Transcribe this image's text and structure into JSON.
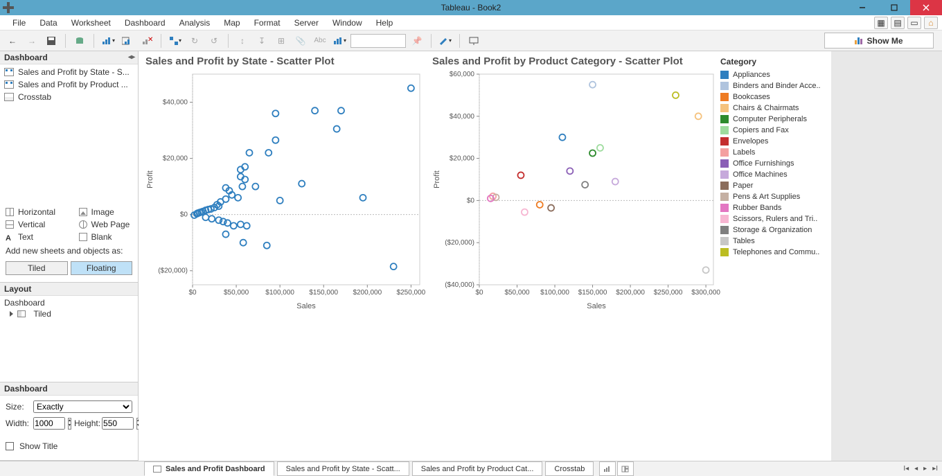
{
  "window": {
    "title": "Tableau - Book2"
  },
  "menu": [
    "File",
    "Data",
    "Worksheet",
    "Dashboard",
    "Analysis",
    "Map",
    "Format",
    "Server",
    "Window",
    "Help"
  ],
  "showme_label": "Show Me",
  "sidebar": {
    "dashboard_title": "Dashboard",
    "sheets": [
      {
        "label": "Sales and Profit by State - S...",
        "type": "db"
      },
      {
        "label": "Sales and Profit by Product ...",
        "type": "db"
      },
      {
        "label": "Crosstab",
        "type": "ct"
      }
    ],
    "objects": {
      "horizontal": "Horizontal",
      "vertical": "Vertical",
      "text": "Text",
      "image": "Image",
      "webpage": "Web Page",
      "blank": "Blank"
    },
    "add_instr": "Add new sheets and objects as:",
    "tiled": "Tiled",
    "floating": "Floating",
    "layout_title": "Layout",
    "layout_root": "Dashboard",
    "layout_child": "Tiled",
    "settings_title": "Dashboard",
    "size_label": "Size:",
    "size_value": "Exactly",
    "width_label": "Width:",
    "width_value": "1000",
    "height_label": "Height:",
    "height_value": "550",
    "show_title": "Show Title"
  },
  "chart1_title": "Sales and Profit by State - Scatter Plot",
  "chart2_title": "Sales and Profit by Product Category - Scatter Plot",
  "axis_x": "Sales",
  "axis_y": "Profit",
  "legend_title": "Category",
  "legend_items": [
    {
      "label": "Appliances",
      "color": "#2f7fbf"
    },
    {
      "label": "Binders and Binder Acce..",
      "color": "#b0c4de"
    },
    {
      "label": "Bookcases",
      "color": "#ee7b22"
    },
    {
      "label": "Chairs & Chairmats",
      "color": "#f5c27d"
    },
    {
      "label": "Computer Peripherals",
      "color": "#2e8b2e"
    },
    {
      "label": "Copiers and Fax",
      "color": "#9edc9e"
    },
    {
      "label": "Envelopes",
      "color": "#c42e2e"
    },
    {
      "label": "Labels",
      "color": "#f4a0a0"
    },
    {
      "label": "Office Furnishings",
      "color": "#8b5fb6"
    },
    {
      "label": "Office Machines",
      "color": "#c6a9db"
    },
    {
      "label": "Paper",
      "color": "#8b6d5c"
    },
    {
      "label": "Pens & Art Supplies",
      "color": "#c5b0a3"
    },
    {
      "label": "Rubber Bands",
      "color": "#e377c2"
    },
    {
      "label": "Scissors, Rulers and Tri..",
      "color": "#f7b6d2"
    },
    {
      "label": "Storage & Organization",
      "color": "#7f7f7f"
    },
    {
      "label": "Tables",
      "color": "#c7c7c7"
    },
    {
      "label": "Telephones and Commu..",
      "color": "#bcbd22"
    }
  ],
  "tabs": [
    {
      "label": "Sales and Profit Dashboard",
      "type": "db",
      "active": true
    },
    {
      "label": "Sales and Profit by State - Scatt...",
      "type": "ws"
    },
    {
      "label": "Sales and Profit by Product Cat...",
      "type": "ws"
    },
    {
      "label": "Crosstab",
      "type": "ws"
    }
  ],
  "chart_data": [
    {
      "type": "scatter",
      "title": "Sales and Profit by State - Scatter Plot",
      "xlabel": "Sales",
      "ylabel": "Profit",
      "xlim": [
        0,
        260000
      ],
      "ylim": [
        -25000,
        50000
      ],
      "xticks": [
        0,
        50000,
        100000,
        150000,
        200000,
        250000
      ],
      "xtick_labels": [
        "$0",
        "$50,000",
        "$100,000",
        "$150,000",
        "$200,000",
        "$250,000"
      ],
      "yticks": [
        -20000,
        0,
        20000,
        40000
      ],
      "ytick_labels": [
        "($20,000)",
        "$0",
        "$20,000",
        "$40,000"
      ],
      "color": "#2f7fbf",
      "points": [
        [
          250000,
          45000
        ],
        [
          170000,
          37000
        ],
        [
          140000,
          37000
        ],
        [
          95000,
          36000
        ],
        [
          165000,
          30500
        ],
        [
          95000,
          26500
        ],
        [
          87000,
          22000
        ],
        [
          65000,
          22000
        ],
        [
          60000,
          17000
        ],
        [
          55000,
          16000
        ],
        [
          55000,
          13500
        ],
        [
          60000,
          12500
        ],
        [
          125000,
          11000
        ],
        [
          72000,
          10000
        ],
        [
          57000,
          10000
        ],
        [
          38000,
          9500
        ],
        [
          42000,
          8500
        ],
        [
          45000,
          7000
        ],
        [
          52000,
          6000
        ],
        [
          38000,
          5500
        ],
        [
          195000,
          6000
        ],
        [
          100000,
          5000
        ],
        [
          32000,
          4500
        ],
        [
          28000,
          3500
        ],
        [
          30000,
          3000
        ],
        [
          25000,
          2500
        ],
        [
          21000,
          2000
        ],
        [
          18000,
          1800
        ],
        [
          15000,
          1500
        ],
        [
          12000,
          1100
        ],
        [
          10000,
          900
        ],
        [
          8000,
          700
        ],
        [
          6000,
          500
        ],
        [
          5000,
          300
        ],
        [
          2000,
          -200
        ],
        [
          15000,
          -1000
        ],
        [
          22000,
          -1500
        ],
        [
          30000,
          -2000
        ],
        [
          35000,
          -2500
        ],
        [
          40000,
          -3000
        ],
        [
          47000,
          -4000
        ],
        [
          55000,
          -3500
        ],
        [
          62000,
          -4000
        ],
        [
          38000,
          -7000
        ],
        [
          58000,
          -10000
        ],
        [
          85000,
          -11000
        ],
        [
          230000,
          -18500
        ]
      ]
    },
    {
      "type": "scatter",
      "title": "Sales and Profit by Product Category - Scatter Plot",
      "xlabel": "Sales",
      "ylabel": "Profit",
      "xlim": [
        0,
        310000
      ],
      "ylim": [
        -40000,
        60000
      ],
      "xticks": [
        0,
        50000,
        100000,
        150000,
        200000,
        250000,
        300000
      ],
      "xtick_labels": [
        "$0",
        "$50,000",
        "$100,000",
        "$150,000",
        "$200,000",
        "$250,000",
        "$300,000"
      ],
      "yticks": [
        -40000,
        -20000,
        0,
        20000,
        40000,
        60000
      ],
      "ytick_labels": [
        "($40,000)",
        "($20,000)",
        "$0",
        "$20,000",
        "$40,000",
        "$60,000"
      ],
      "points": [
        {
          "x": 150000,
          "y": 55000,
          "color": "#b0c4de"
        },
        {
          "x": 260000,
          "y": 50000,
          "color": "#bcbd22"
        },
        {
          "x": 290000,
          "y": 40000,
          "color": "#f5c27d"
        },
        {
          "x": 110000,
          "y": 30000,
          "color": "#2f7fbf"
        },
        {
          "x": 160000,
          "y": 25000,
          "color": "#9edc9e"
        },
        {
          "x": 150000,
          "y": 22500,
          "color": "#2e8b2e"
        },
        {
          "x": 120000,
          "y": 14000,
          "color": "#8b5fb6"
        },
        {
          "x": 55000,
          "y": 12000,
          "color": "#c42e2e"
        },
        {
          "x": 180000,
          "y": 9000,
          "color": "#c6a9db"
        },
        {
          "x": 140000,
          "y": 7500,
          "color": "#7f7f7f"
        },
        {
          "x": 18000,
          "y": 2000,
          "color": "#f4a0a0"
        },
        {
          "x": 22000,
          "y": 1500,
          "color": "#c5b0a3"
        },
        {
          "x": 15000,
          "y": 1000,
          "color": "#e377c2"
        },
        {
          "x": 80000,
          "y": -2000,
          "color": "#ee7b22"
        },
        {
          "x": 95000,
          "y": -3500,
          "color": "#8b6d5c"
        },
        {
          "x": 60000,
          "y": -5500,
          "color": "#f7b6d2"
        },
        {
          "x": 300000,
          "y": -33000,
          "color": "#c7c7c7"
        }
      ]
    }
  ]
}
